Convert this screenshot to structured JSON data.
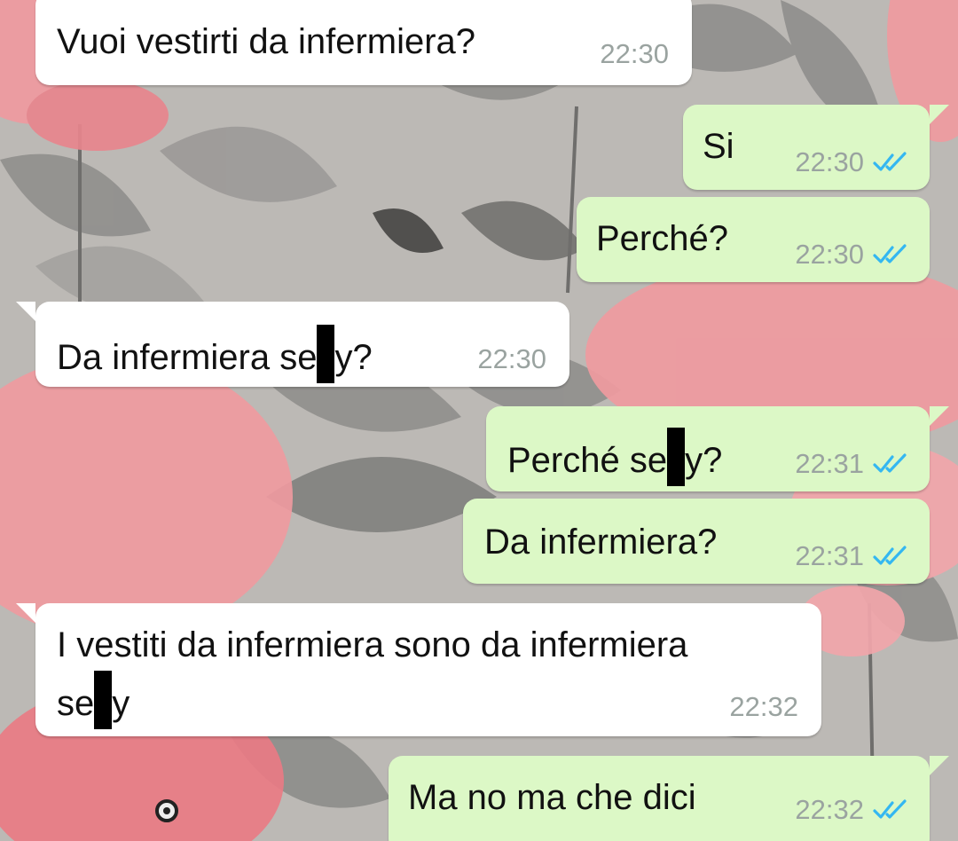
{
  "colors": {
    "incoming_bubble": "#ffffff",
    "outgoing_bubble": "#dcf8c6",
    "read_ticks": "#34b7f1",
    "timestamp": "#9aa3a0"
  },
  "messages": [
    {
      "direction": "incoming",
      "text": "Vuoi vestirti da infermiera?",
      "time": "22:30"
    },
    {
      "direction": "outgoing",
      "text": "Si",
      "time": "22:30",
      "status": "read"
    },
    {
      "direction": "outgoing",
      "text": "Perché?",
      "time": "22:30",
      "status": "read"
    },
    {
      "direction": "incoming",
      "text_before": "Da infermiera se",
      "text_after": "y?",
      "redacted": true,
      "time": "22:30"
    },
    {
      "direction": "outgoing",
      "text_before": "Perché se",
      "text_after": "y?",
      "redacted": true,
      "time": "22:31",
      "status": "read"
    },
    {
      "direction": "outgoing",
      "text": "Da infermiera?",
      "time": "22:31",
      "status": "read"
    },
    {
      "direction": "incoming",
      "line1": "I vestiti da infermiera sono da infermiera",
      "line2_before": "se",
      "line2_after": "y",
      "redacted": true,
      "time": "22:32"
    },
    {
      "direction": "outgoing",
      "text": "Ma no ma che dici",
      "time": "22:32",
      "status": "read"
    }
  ]
}
